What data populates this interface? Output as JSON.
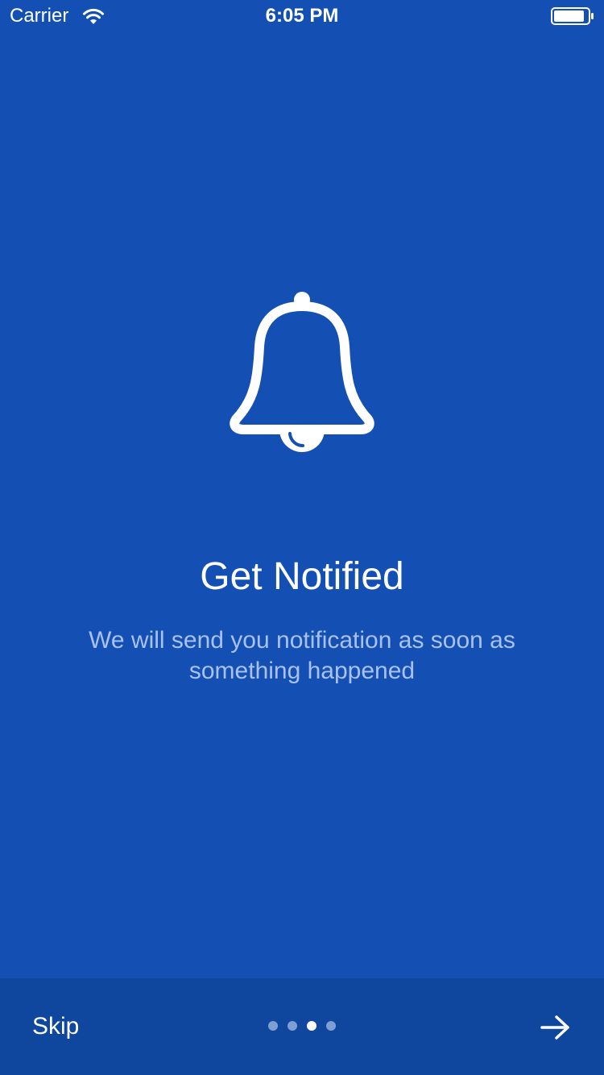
{
  "status_bar": {
    "carrier": "Carrier",
    "time": "6:05 PM",
    "icons": [
      "wifi-icon",
      "battery-icon"
    ]
  },
  "onboarding": {
    "icon": "bell-icon",
    "title": "Get Notified",
    "subtitle": "We will send you notification as soon as something happened"
  },
  "bottom_bar": {
    "skip_label": "Skip",
    "page_count": 4,
    "current_page": 3,
    "next_icon": "arrow-right-icon"
  },
  "colors": {
    "background": "#1450b4",
    "bottom_bar": "#0f469e",
    "subtitle": "#a9c1ee",
    "dot_inactive": "#7f9fd4",
    "dot_active": "#ffffff"
  }
}
